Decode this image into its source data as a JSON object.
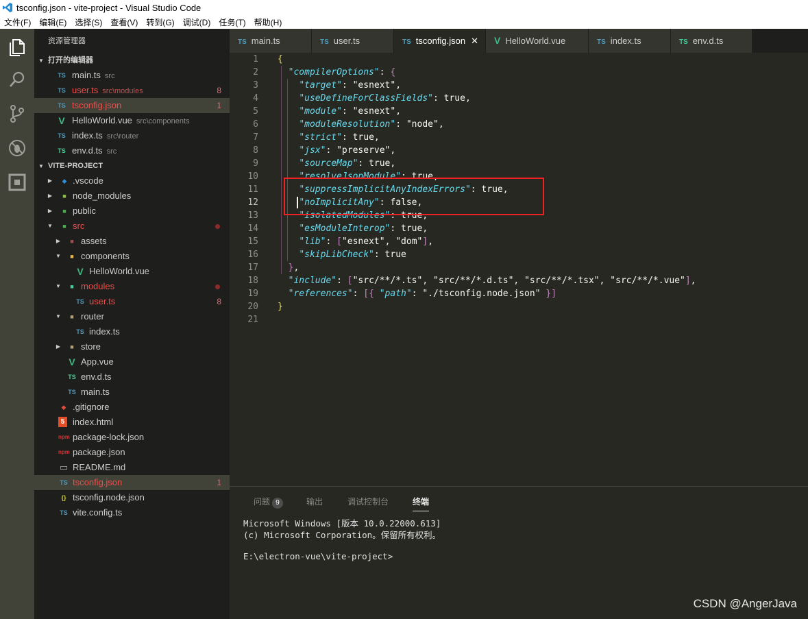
{
  "window": {
    "title": "tsconfig.json - vite-project - Visual Studio Code"
  },
  "menu": [
    "文件(F)",
    "编辑(E)",
    "选择(S)",
    "查看(V)",
    "转到(G)",
    "调试(D)",
    "任务(T)",
    "帮助(H)"
  ],
  "sidebar": {
    "title": "资源管理器",
    "open_editors_label": "打开的编辑器",
    "open_editors": [
      {
        "icon": "TS",
        "name": "main.ts",
        "desc": "src",
        "badge": ""
      },
      {
        "icon": "TS",
        "name": "user.ts",
        "desc": "src\\modules",
        "badge": "8"
      },
      {
        "icon": "TS",
        "name": "tsconfig.json",
        "desc": "",
        "badge": "1"
      },
      {
        "icon": "V",
        "name": "HelloWorld.vue",
        "desc": "src\\components",
        "badge": ""
      },
      {
        "icon": "TS",
        "name": "index.ts",
        "desc": "src\\router",
        "badge": ""
      },
      {
        "icon": "TS",
        "name": "env.d.ts",
        "desc": "src",
        "badge": ""
      }
    ],
    "project_label": "VITE-PROJECT",
    "tree": [
      {
        "name": ".vscode"
      },
      {
        "name": "node_modules"
      },
      {
        "name": "public"
      },
      {
        "name": "src"
      },
      {
        "name": "assets"
      },
      {
        "name": "components"
      },
      {
        "name": "HelloWorld.vue"
      },
      {
        "name": "modules"
      },
      {
        "name": "user.ts",
        "badge": "8"
      },
      {
        "name": "router"
      },
      {
        "name": "index.ts"
      },
      {
        "name": "store"
      },
      {
        "name": "App.vue"
      },
      {
        "name": "env.d.ts"
      },
      {
        "name": "main.ts"
      },
      {
        "name": ".gitignore"
      },
      {
        "name": "index.html"
      },
      {
        "name": "package-lock.json"
      },
      {
        "name": "package.json"
      },
      {
        "name": "README.md"
      },
      {
        "name": "tsconfig.json",
        "badge": "1"
      },
      {
        "name": "tsconfig.node.json"
      },
      {
        "name": "vite.config.ts"
      }
    ]
  },
  "tabs": [
    {
      "icon": "TS",
      "label": "main.ts"
    },
    {
      "icon": "TS",
      "label": "user.ts"
    },
    {
      "icon": "TS",
      "label": "tsconfig.json",
      "close": "✕"
    },
    {
      "icon": "V",
      "label": "HelloWorld.vue"
    },
    {
      "icon": "TS",
      "label": "index.ts"
    },
    {
      "icon": "TS",
      "label": "env.d.ts"
    }
  ],
  "editor": {
    "line_numbers": [
      "1",
      "2",
      "3",
      "4",
      "5",
      "6",
      "7",
      "8",
      "9",
      "10",
      "11",
      "12",
      "13",
      "14",
      "15",
      "16",
      "17",
      "18",
      "19",
      "20",
      "21"
    ],
    "lines": [
      "{",
      "  \"compilerOptions\": {",
      "    \"target\": \"esnext\",",
      "    \"useDefineForClassFields\": true,",
      "    \"module\": \"esnext\",",
      "    \"moduleResolution\": \"node\",",
      "    \"strict\": true,",
      "    \"jsx\": \"preserve\",",
      "    \"sourceMap\": true,",
      "    \"resolveJsonModule\": true,",
      "    \"suppressImplicitAnyIndexErrors\": true,",
      "    \"noImplicitAny\": false,",
      "    \"isolatedModules\": true,",
      "    \"esModuleInterop\": true,",
      "    \"lib\": [\"esnext\", \"dom\"],",
      "    \"skipLibCheck\": true",
      "  },",
      "  \"include\": [\"src/**/*.ts\", \"src/**/*.d.ts\", \"src/**/*.tsx\", \"src/**/*.vue\"],",
      "  \"references\": [{ \"path\": \"./tsconfig.node.json\" }]",
      "}",
      ""
    ]
  },
  "panel": {
    "tabs": [
      "问题",
      "输出",
      "调试控制台",
      "终端"
    ],
    "problems_count": "9",
    "terminal_lines": [
      "Microsoft Windows [版本 10.0.22000.613]",
      "(c) Microsoft Corporation。保留所有权利。",
      "",
      "E:\\electron-vue\\vite-project>"
    ]
  },
  "watermark": "CSDN @AngerJava"
}
